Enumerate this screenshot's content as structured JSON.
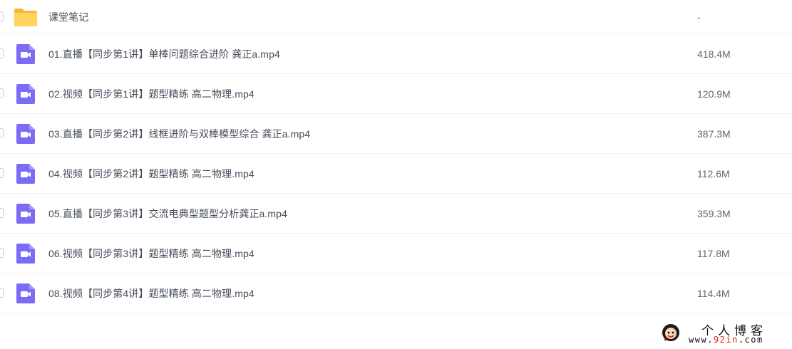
{
  "files": [
    {
      "type": "folder",
      "icon": "folder-icon",
      "name": "课堂笔记",
      "size": "-"
    },
    {
      "type": "video",
      "icon": "video-file-icon",
      "name": "01.直播【同步第1讲】单棒问题综合进阶 龚正a.mp4",
      "size": "418.4M"
    },
    {
      "type": "video",
      "icon": "video-file-icon",
      "name": "02.视频【同步第1讲】题型精练 高二物理.mp4",
      "size": "120.9M"
    },
    {
      "type": "video",
      "icon": "video-file-icon",
      "name": "03.直播【同步第2讲】线框进阶与双棒模型综合 龚正a.mp4",
      "size": "387.3M"
    },
    {
      "type": "video",
      "icon": "video-file-icon",
      "name": "04.视频【同步第2讲】题型精练 高二物理.mp4",
      "size": "112.6M"
    },
    {
      "type": "video",
      "icon": "video-file-icon",
      "name": "05.直播【同步第3讲】交流电典型题型分析龚正a.mp4",
      "size": "359.3M"
    },
    {
      "type": "video",
      "icon": "video-file-icon",
      "name": "06.视频【同步第3讲】题型精练 高二物理.mp4",
      "size": "117.8M"
    },
    {
      "type": "video",
      "icon": "video-file-icon",
      "name": "08.视频【同步第4讲】题型精练 高二物理.mp4",
      "size": "114.4M"
    }
  ],
  "watermark": {
    "title": "个人博客",
    "url_prefix": "www.",
    "url_highlight": "92in",
    "url_suffix": ".com"
  },
  "colors": {
    "folder": "#ffd35c",
    "video": "#7b6cf6",
    "text": "#454d5a"
  }
}
